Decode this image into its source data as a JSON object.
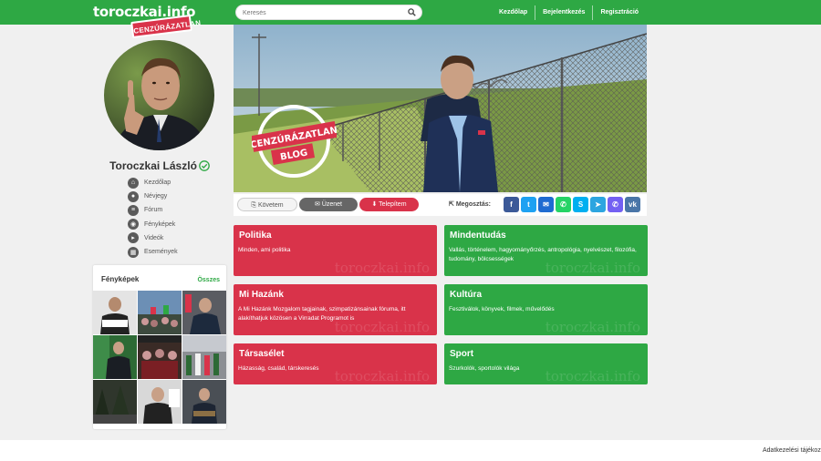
{
  "header": {
    "brand": "toroczkai.info",
    "brand_tag": "CENZÚRÁZATLAN",
    "search_placeholder": "Keresés",
    "nav": [
      "Kezdőlap",
      "Bejelentkezés",
      "Regisztráció"
    ],
    "accent_color": "#2ea844"
  },
  "profile": {
    "name": "Toroczkai László",
    "nav": [
      {
        "label": "Kezdőlap",
        "icon": "home-icon"
      },
      {
        "label": "Névjegy",
        "icon": "user-icon"
      },
      {
        "label": "Fórum",
        "icon": "forum-icon"
      },
      {
        "label": "Fényképek",
        "icon": "camera-icon"
      },
      {
        "label": "Videók",
        "icon": "video-icon"
      },
      {
        "label": "Események",
        "icon": "calendar-icon"
      }
    ]
  },
  "photos": {
    "title": "Fényképek",
    "all_label": "Összes"
  },
  "hero": {
    "stamp_top": "CENZÚRÁZATLAN",
    "stamp_bottom": "BLOG"
  },
  "actions": {
    "follow_label": "Követem",
    "message_label": "Üzenet",
    "install_label": "Telepítem",
    "share_label": "Megosztás:",
    "share_icons": [
      "facebook-icon",
      "twitter-icon",
      "email-icon",
      "whatsapp-icon",
      "skype-icon",
      "telegram-icon",
      "viber-icon",
      "vk-icon"
    ]
  },
  "categories": [
    {
      "title": "Politika",
      "desc": "Minden, ami politika",
      "color": "#d9334a"
    },
    {
      "title": "Mindentudás",
      "desc": "Vallás, történelem, hagyományőrzés, antropológia, nyelvészet, filozófia, tudomány, bölcsességek",
      "color": "#2ea844"
    },
    {
      "title": "Mi Hazánk",
      "desc": "A Mi Hazánk Mozgalom tagjainak, szimpatizánsainak fóruma, itt alakíthatjuk közösen a Virradat Programot is",
      "color": "#d9334a"
    },
    {
      "title": "Kultúra",
      "desc": "Fesztiválok, könyvek, filmek, művelődés",
      "color": "#2ea844"
    },
    {
      "title": "Társasélet",
      "desc": "Házasság, család, társkeresés",
      "color": "#d9334a"
    },
    {
      "title": "Sport",
      "desc": "Szurkolók, sportolók világa",
      "color": "#2ea844"
    }
  ],
  "watermark": "toroczkai.info",
  "footer": {
    "link": "Adatkezelési tájékoz"
  }
}
